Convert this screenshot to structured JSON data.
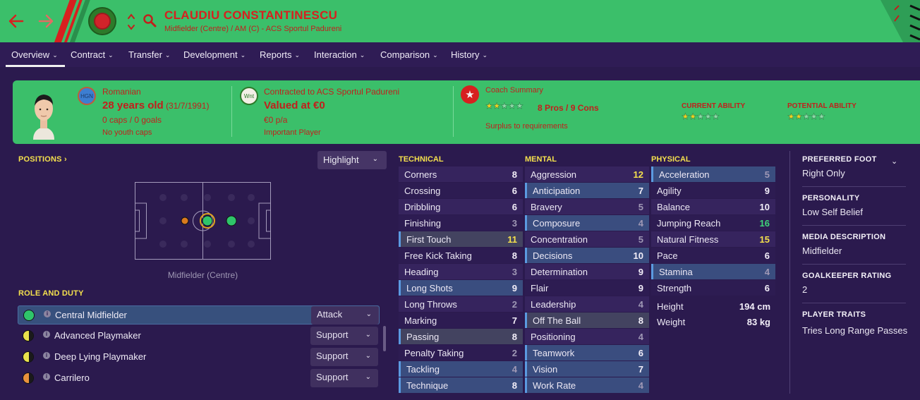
{
  "header": {
    "name": "CLAUDIU CONSTANTINESCU",
    "subtitle": "Midfielder (Centre) / AM (C) - ACS Sportul Padureni",
    "back_icon": "arrow-left",
    "forward_icon": "arrow-right",
    "search_icon": "magnifier",
    "colors": {
      "bar": "#3bbf6a",
      "accent": "#d7201f"
    }
  },
  "tabs": [
    {
      "label": "Overview",
      "active": true
    },
    {
      "label": "Contract"
    },
    {
      "label": "Transfer"
    },
    {
      "label": "Development"
    },
    {
      "label": "Reports"
    },
    {
      "label": "Interaction"
    },
    {
      "label": "Comparison"
    },
    {
      "label": "History"
    }
  ],
  "info": {
    "nationality": "Romanian",
    "nation_badge": "HGN",
    "age": "28 years old",
    "dob": "(31/7/1991)",
    "caps": "0 caps / 0 goals",
    "youth_caps": "No youth caps",
    "contract": "Contracted to ACS Sportul Padureni",
    "contract_badge": "Wnt",
    "value": "Valued at €0",
    "wage": "€0 p/a",
    "status": "Important Player",
    "coach_title": "Coach Summary",
    "coach_stars": 2,
    "pros_cons": "8 Pros / 9 Cons",
    "surplus": "Surplus to requirements",
    "current_ability_label": "CURRENT ABILITY",
    "current_ability_stars": 2,
    "potential_ability_label": "POTENTIAL ABILITY",
    "potential_ability_stars": 2
  },
  "positions": {
    "title": "POSITIONS",
    "highlight_label": "Highlight",
    "pitch_caption": "Midfielder (Centre)"
  },
  "roles": {
    "title": "ROLE AND DUTY",
    "items": [
      {
        "name": "Central Midfielder",
        "duty": "Attack",
        "left": "#2fc56a",
        "right": "#2fc56a",
        "selected": true
      },
      {
        "name": "Advanced Playmaker",
        "duty": "Support",
        "left": "#e9e24c",
        "right": "#1a1a1a"
      },
      {
        "name": "Deep Lying Playmaker",
        "duty": "Support",
        "left": "#e9e24c",
        "right": "#1a1a1a"
      },
      {
        "name": "Carrilero",
        "duty": "Support",
        "left": "#e9923c",
        "right": "#1a1a1a"
      }
    ]
  },
  "technical": {
    "title": "TECHNICAL",
    "items": [
      {
        "name": "Corners",
        "value": "8"
      },
      {
        "name": "Crossing",
        "value": "6"
      },
      {
        "name": "Dribbling",
        "value": "6"
      },
      {
        "name": "Finishing",
        "value": "3"
      },
      {
        "name": "First Touch",
        "value": "11",
        "style": "hl2"
      },
      {
        "name": "Free Kick Taking",
        "value": "8"
      },
      {
        "name": "Heading",
        "value": "3"
      },
      {
        "name": "Long Shots",
        "value": "9",
        "style": "hl"
      },
      {
        "name": "Long Throws",
        "value": "2"
      },
      {
        "name": "Marking",
        "value": "7"
      },
      {
        "name": "Passing",
        "value": "8",
        "style": "hl2"
      },
      {
        "name": "Penalty Taking",
        "value": "2"
      },
      {
        "name": "Tackling",
        "value": "4",
        "style": "hl"
      },
      {
        "name": "Technique",
        "value": "8",
        "style": "hl"
      }
    ]
  },
  "mental": {
    "title": "MENTAL",
    "items": [
      {
        "name": "Aggression",
        "value": "12"
      },
      {
        "name": "Anticipation",
        "value": "7",
        "style": "hl"
      },
      {
        "name": "Bravery",
        "value": "5"
      },
      {
        "name": "Composure",
        "value": "4",
        "style": "hl"
      },
      {
        "name": "Concentration",
        "value": "5"
      },
      {
        "name": "Decisions",
        "value": "10",
        "style": "hl"
      },
      {
        "name": "Determination",
        "value": "9"
      },
      {
        "name": "Flair",
        "value": "9"
      },
      {
        "name": "Leadership",
        "value": "4"
      },
      {
        "name": "Off The Ball",
        "value": "8",
        "style": "hl2"
      },
      {
        "name": "Positioning",
        "value": "4"
      },
      {
        "name": "Teamwork",
        "value": "6",
        "style": "hl"
      },
      {
        "name": "Vision",
        "value": "7",
        "style": "hl"
      },
      {
        "name": "Work Rate",
        "value": "4",
        "style": "hl"
      }
    ]
  },
  "physical": {
    "title": "PHYSICAL",
    "items": [
      {
        "name": "Acceleration",
        "value": "5",
        "style": "hl"
      },
      {
        "name": "Agility",
        "value": "9"
      },
      {
        "name": "Balance",
        "value": "10"
      },
      {
        "name": "Jumping Reach",
        "value": "16"
      },
      {
        "name": "Natural Fitness",
        "value": "15"
      },
      {
        "name": "Pace",
        "value": "6"
      },
      {
        "name": "Stamina",
        "value": "4",
        "style": "hl"
      },
      {
        "name": "Strength",
        "value": "6"
      }
    ],
    "height_label": "Height",
    "height": "194 cm",
    "weight_label": "Weight",
    "weight": "83 kg"
  },
  "right_panel": {
    "preferred_foot_title": "PREFERRED FOOT",
    "preferred_foot": "Right Only",
    "personality_title": "PERSONALITY",
    "personality": "Low Self Belief",
    "media_title": "MEDIA DESCRIPTION",
    "media": "Midfielder",
    "gk_title": "GOALKEEPER RATING",
    "gk": "2",
    "traits_title": "PLAYER TRAITS",
    "traits": "Tries Long Range Passes"
  }
}
